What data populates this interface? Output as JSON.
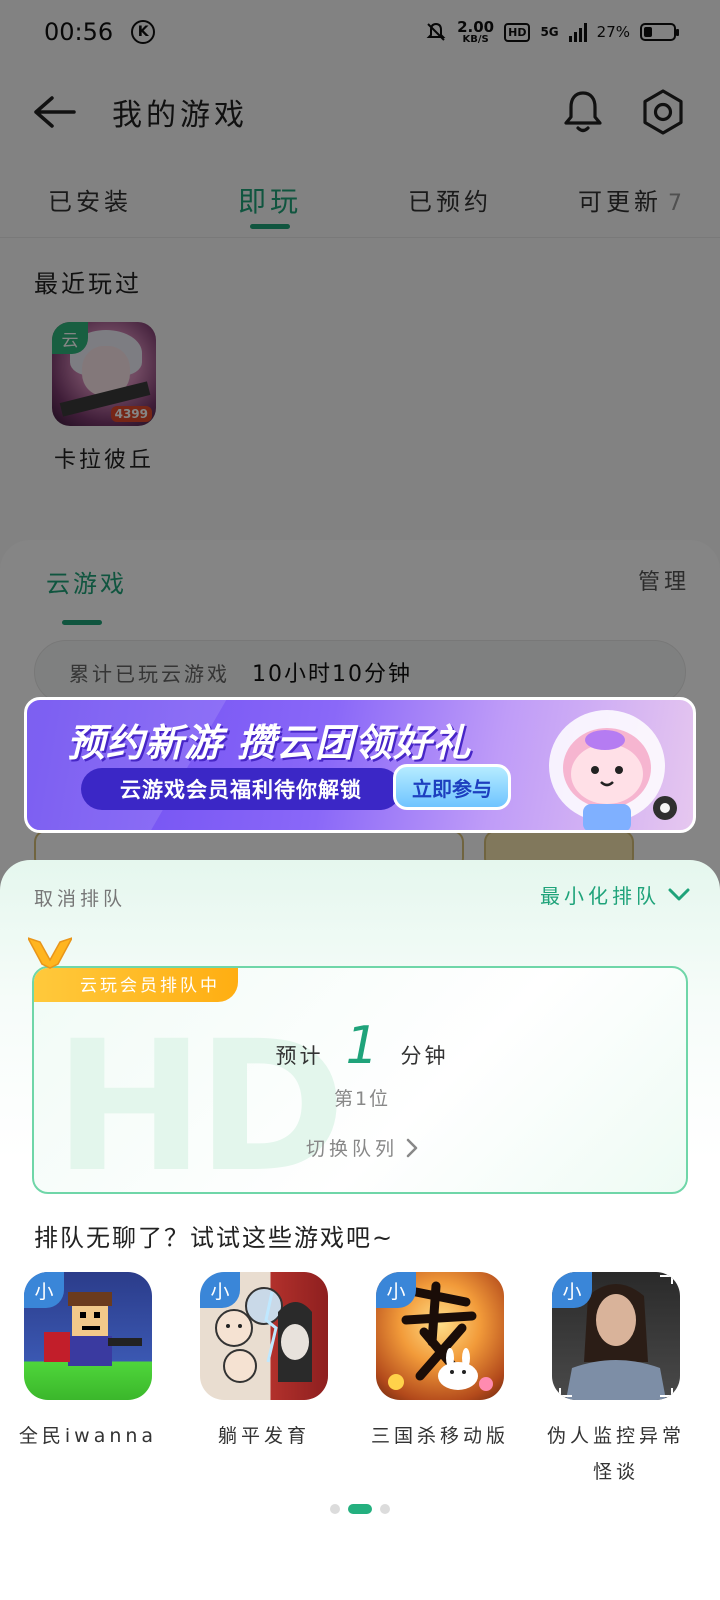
{
  "status_bar": {
    "time": "00:56",
    "k_badge": "K",
    "net_speed_value": "2.00",
    "net_speed_unit": "KB/S",
    "hd": "HD",
    "network": "5G",
    "battery_percent": "27%",
    "battery_level": 0.27
  },
  "header": {
    "title": "我的游戏"
  },
  "tabs": [
    {
      "label": "已安装",
      "active": false
    },
    {
      "label": "即玩",
      "active": true
    },
    {
      "label": "已预约",
      "active": false
    },
    {
      "label": "可更新",
      "count": "7",
      "active": false
    }
  ],
  "recent": {
    "title": "最近玩过",
    "items": [
      {
        "name": "卡拉彼丘",
        "tag": "云",
        "brand": "4399"
      }
    ]
  },
  "cloud": {
    "tab": "云游戏",
    "manage": "管理",
    "played_label": "累计已玩云游戏",
    "played_value": "10小时10分钟"
  },
  "banner": {
    "title": "预约新游 攒云团领好礼",
    "subtitle": "云游戏会员福利待你解锁",
    "button": "立即参与"
  },
  "sheet": {
    "cancel_label": "取消排队",
    "minimize_label": "最小化排队",
    "vip_badge": "云玩会员排队中",
    "eta_prefix": "预计",
    "eta_value": "1",
    "eta_unit": "分钟",
    "position": "第1位",
    "switch_label": "切换队列",
    "watermark": "HD",
    "bored_title": "排队无聊了？试试这些游戏吧~",
    "games": [
      {
        "name": "全民iwanna",
        "tag": "小"
      },
      {
        "name": "躺平发育",
        "tag": "小"
      },
      {
        "name": "三国杀移动版",
        "tag": "小"
      },
      {
        "name": "伪人监控异常怪谈",
        "tag": "小"
      }
    ],
    "pager": {
      "count": 3,
      "active": 1
    }
  },
  "colors": {
    "accent": "#1fa37a",
    "vip": "#ffb31a",
    "mini_tag": "#3a86d8"
  }
}
